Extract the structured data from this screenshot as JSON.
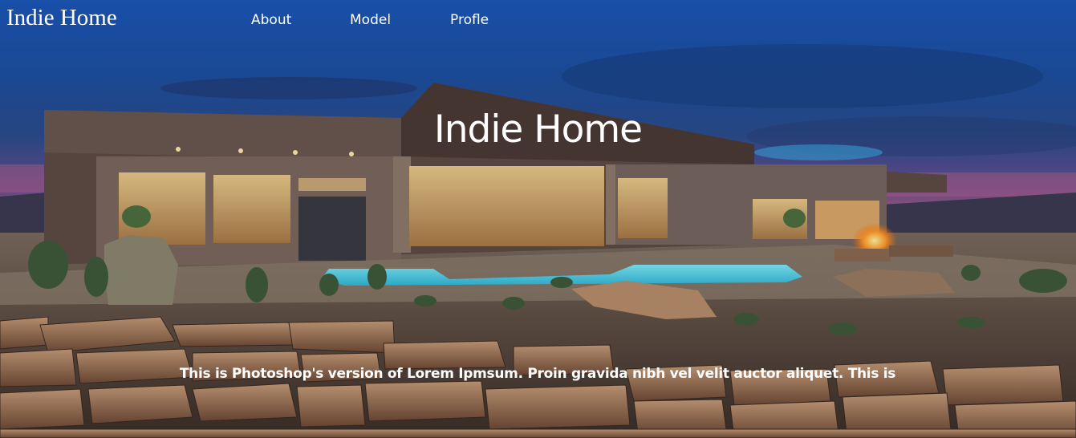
{
  "header": {
    "brand": "Indie Home",
    "nav": [
      {
        "label": "About"
      },
      {
        "label": "Model"
      },
      {
        "label": "Profle"
      }
    ]
  },
  "hero": {
    "title": "Indie Home",
    "text": "This is Photoshop's version of Lorem Ipmsum. Proin gravida nibh vel velit auctor aliquet. This is",
    "image": "house-at-dusk-photo"
  }
}
